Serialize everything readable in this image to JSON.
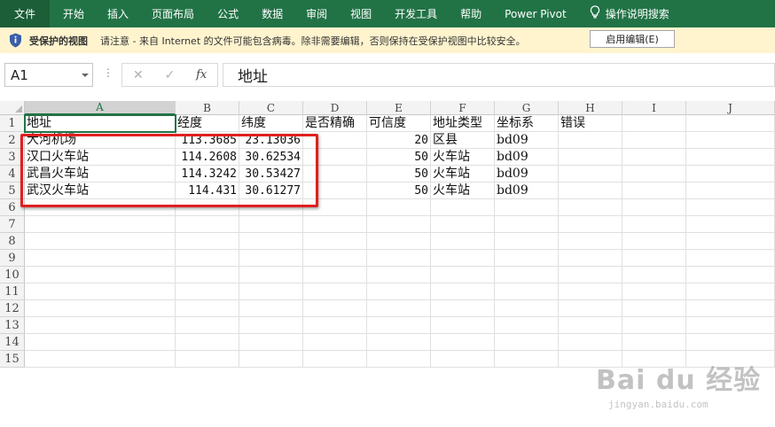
{
  "ribbon": {
    "file": "文件",
    "tabs": [
      "开始",
      "插入",
      "页面布局",
      "公式",
      "数据",
      "审阅",
      "视图",
      "开发工具",
      "帮助",
      "Power Pivot"
    ],
    "tell_me": "操作说明搜索"
  },
  "protected_view": {
    "title": "受保护的视图",
    "message": "请注意 - 来自 Internet 的文件可能包含病毒。除非需要编辑，否则保持在受保护视图中比较安全。",
    "enable_button": "启用编辑(E)"
  },
  "formula_bar": {
    "name_box": "A1",
    "fx": "fx",
    "value": "地址"
  },
  "grid": {
    "columns": [
      "A",
      "B",
      "C",
      "D",
      "E",
      "F",
      "G",
      "H",
      "I",
      "J"
    ],
    "rows": [
      "1",
      "2",
      "3",
      "4",
      "5",
      "6",
      "7",
      "8",
      "9",
      "10",
      "11",
      "12",
      "13",
      "14",
      "15"
    ],
    "headers": [
      "地址",
      "经度",
      "纬度",
      "是否精确",
      "可信度",
      "地址类型",
      "坐标系",
      "错误"
    ],
    "data": [
      [
        "大河机场",
        "113.3685",
        "23.13036",
        "",
        "20",
        "区县",
        "bd09",
        ""
      ],
      [
        "汉口火车站",
        "114.2608",
        "30.62534",
        "",
        "50",
        "火车站",
        "bd09",
        ""
      ],
      [
        "武昌火车站",
        "114.3242",
        "30.53427",
        "",
        "50",
        "火车站",
        "bd09",
        ""
      ],
      [
        "武汉火车站",
        "114.431",
        "30.61277",
        "",
        "50",
        "火车站",
        "bd09",
        ""
      ]
    ]
  },
  "watermark": {
    "logo": "Bai du 经验",
    "url": "jingyan.baidu.com"
  },
  "colors": {
    "ribbon": "#217346",
    "protected_bar": "#fff4ce",
    "highlight_box": "#e0201f"
  }
}
